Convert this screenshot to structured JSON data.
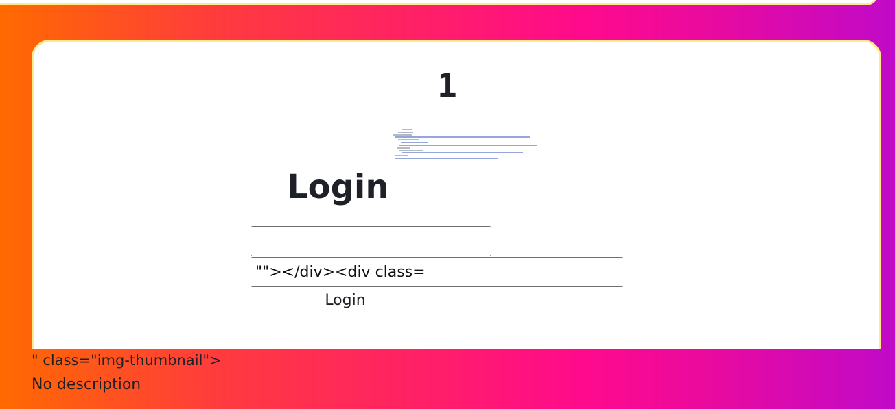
{
  "card": {
    "counter": "1",
    "login_title": "Login",
    "username_value": "",
    "password_value": "\"\"></div><div class=",
    "login_button_label": "Login"
  },
  "below_card": {
    "leaked_markup": "\" class=\"img-thumbnail\">",
    "description": "No description"
  },
  "colors": {
    "gradient_start": "#ff6a00",
    "gradient_mid": "#ff0a8c",
    "gradient_end": "#c00ac8",
    "card_border": "#ffe98a",
    "text": "#1e2128"
  }
}
